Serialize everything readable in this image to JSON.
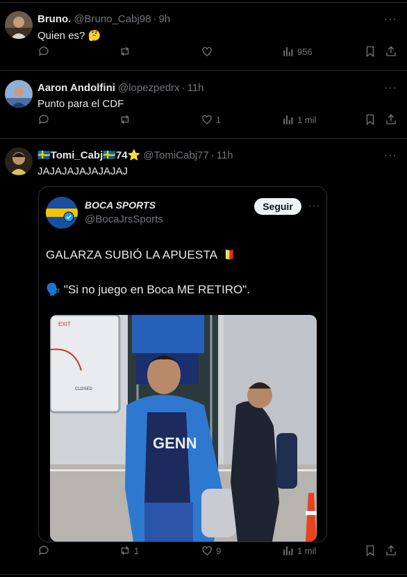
{
  "posts": [
    {
      "name": "Bruno.",
      "handle": "@Bruno_Cabj98",
      "dot": "·",
      "time": "9h",
      "text": "Quien es? 🤔",
      "replies": "",
      "reposts": "",
      "likes": "",
      "views": "956"
    },
    {
      "name": "Aaron Andolfini",
      "handle": "@lopezpedrx",
      "dot": "·",
      "time": "11h",
      "text": "Punto para el CDF",
      "replies": "",
      "reposts": "",
      "likes": "1",
      "views": "1 mil"
    },
    {
      "name": "🇸🇪Tomi_Cabj🇸🇪74⭐",
      "handle": "@TomiCabj77",
      "dot": "·",
      "time": "11h",
      "text": "JAJAJAJAJAJAJAJ",
      "replies": "",
      "reposts": "1",
      "likes": "9",
      "views": "1 mil"
    }
  ],
  "quote": {
    "name": "BOCA SPORTS",
    "handle": "@BocaJrsSports",
    "follow_label": "Seguir",
    "line1": "GALARZA SUBIÓ LA APUESTA 🇧🇪",
    "line2": "🗣️ \"Si no juego en Boca ME RETIRO\".",
    "image_text": {
      "exit": "EXIT",
      "closed": "CLOSED",
      "shirt": "GENN"
    }
  },
  "more_glyph": "···",
  "colors": {
    "background": "#000000",
    "border": "#2f3336",
    "muted": "#71767b",
    "text": "#e7e9ea",
    "follow_bg": "#eff3f4"
  }
}
